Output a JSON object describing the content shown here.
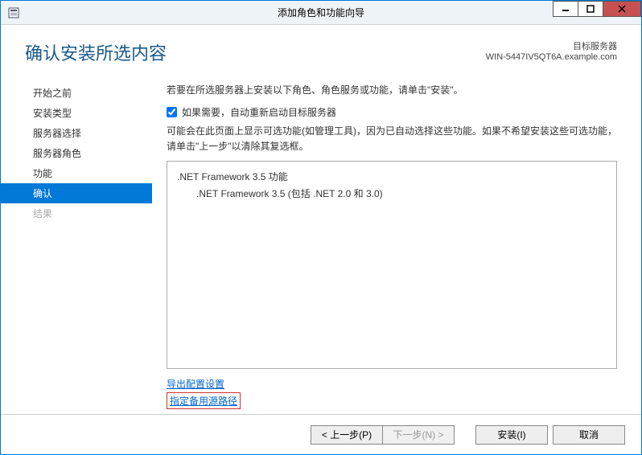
{
  "titlebar": {
    "title": "添加角色和功能向导"
  },
  "header": {
    "pageTitle": "确认安装所选内容",
    "serverLabel": "目标服务器",
    "serverName": "WIN-5447IV5QT6A.example.com"
  },
  "sidebar": {
    "items": [
      {
        "label": "开始之前",
        "state": "normal"
      },
      {
        "label": "安装类型",
        "state": "normal"
      },
      {
        "label": "服务器选择",
        "state": "normal"
      },
      {
        "label": "服务器角色",
        "state": "normal"
      },
      {
        "label": "功能",
        "state": "normal"
      },
      {
        "label": "确认",
        "state": "selected"
      },
      {
        "label": "结果",
        "state": "disabled"
      }
    ]
  },
  "content": {
    "introText": "若要在所选服务器上安装以下角色、角色服务或功能，请单击\"安装\"。",
    "checkboxLabel": "如果需要，自动重新启动目标服务器",
    "noteText": "可能会在此页面上显示可选功能(如管理工具)，因为已自动选择这些功能。如果不希望安装这些可选功能，请单击\"上一步\"以清除其复选框。",
    "features": [
      {
        "label": ".NET Framework 3.5 功能",
        "indent": false
      },
      {
        "label": ".NET Framework 3.5 (包括 .NET 2.0 和 3.0)",
        "indent": true
      }
    ],
    "exportLink": "导出配置设置",
    "sourceLink": "指定备用源路径"
  },
  "buttons": {
    "prev": "< 上一步(P)",
    "next": "下一步(N) >",
    "install": "安装(I)",
    "cancel": "取消"
  }
}
